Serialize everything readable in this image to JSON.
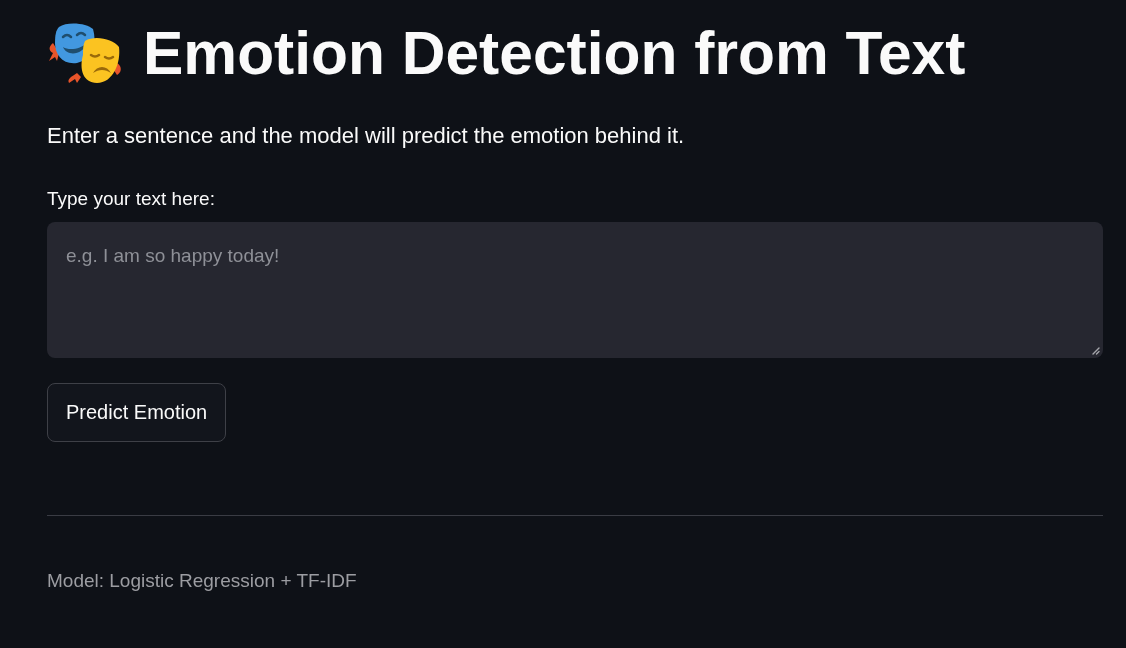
{
  "header": {
    "title": "Emotion Detection from Text"
  },
  "description": "Enter a sentence and the model will predict the emotion behind it.",
  "text_input": {
    "label": "Type your text here:",
    "placeholder": "e.g. I am so happy today!"
  },
  "predict_button": {
    "label": "Predict Emotion"
  },
  "footer": {
    "caption": "Model: Logistic Regression + TF-IDF"
  }
}
